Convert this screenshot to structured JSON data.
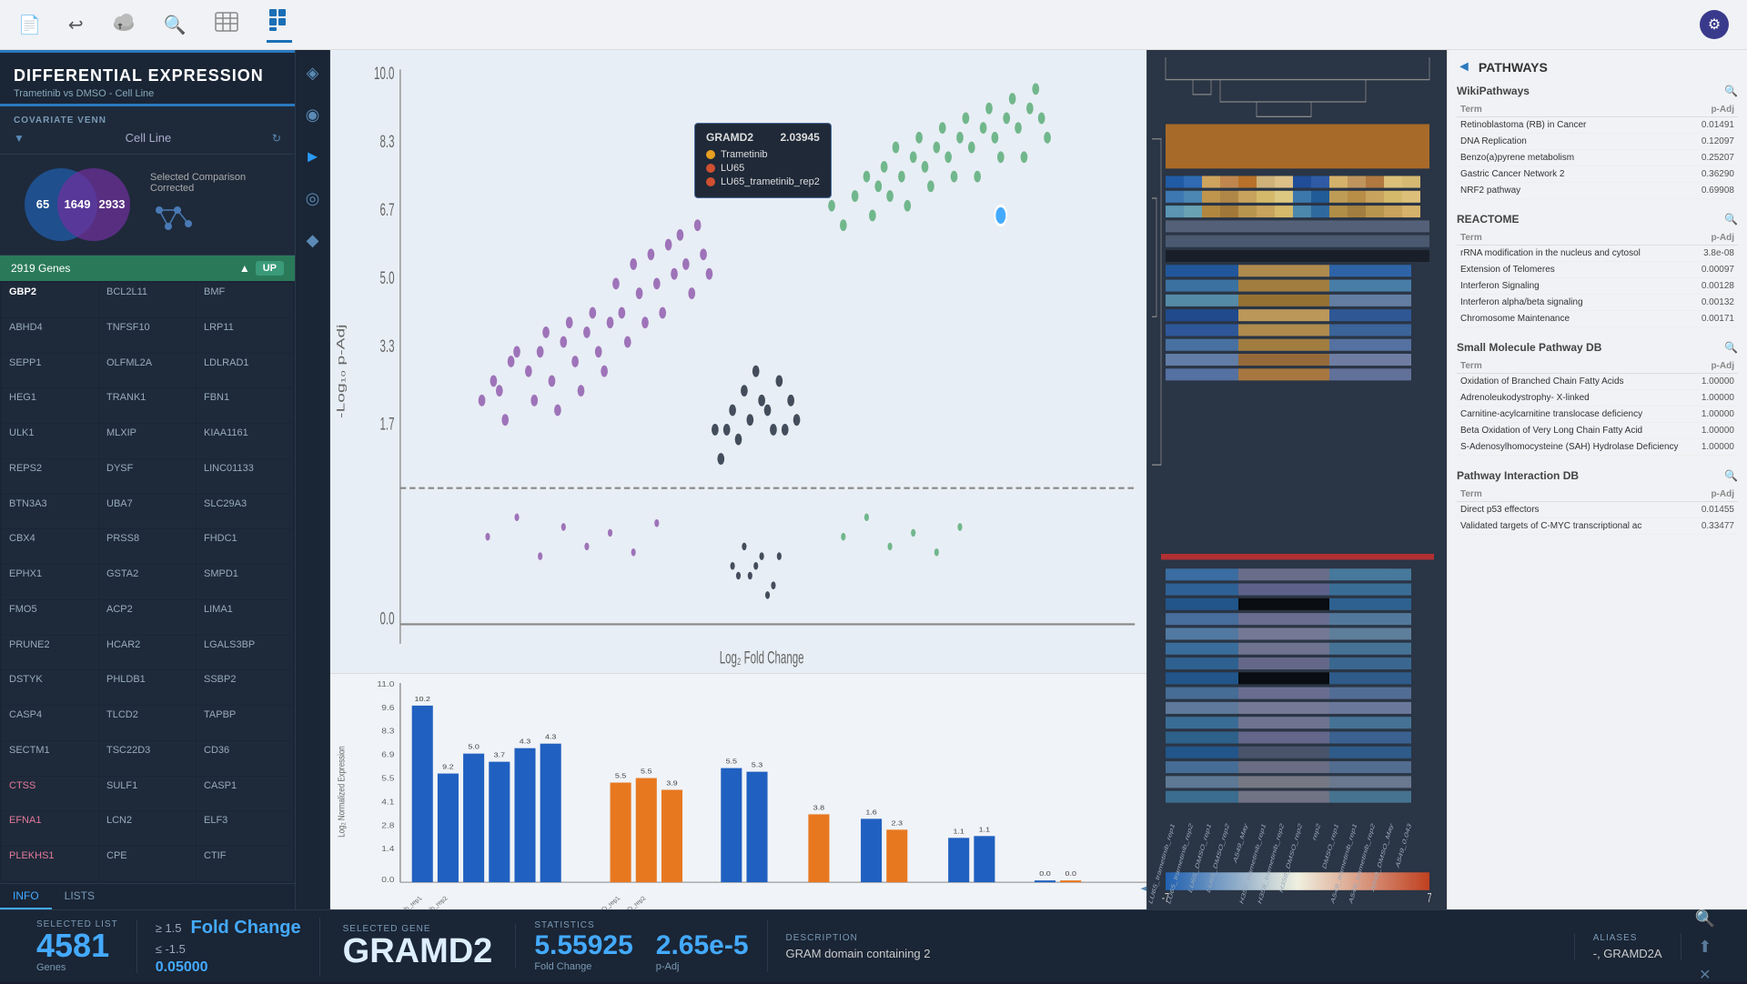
{
  "app": {
    "title": "DIFFERENTIAL EXPRESSION",
    "subtitle": "Trametinib vs DMSO - Cell Line"
  },
  "toolbar": {
    "icons": [
      "📄",
      "↩",
      "☁",
      "🔍",
      "📊",
      "⬛"
    ],
    "active_index": 5,
    "settings": "⚙"
  },
  "sidebar": {
    "covariate_label": "COVARIATE VENN",
    "cell_line_label": "Cell Line",
    "venn": {
      "left_value": "65",
      "center_value": "1649",
      "right_value": "2933",
      "selected_label": "Selected Comparison",
      "corrected_label": "Corrected"
    },
    "gene_list": {
      "count": "2919 Genes",
      "direction": "UP",
      "genes_col1": [
        "GBP2",
        "ABHD4",
        "SEPP1",
        "HEG1",
        "ULK1",
        "REPS2",
        "BTN3A3",
        "CBX4",
        "EPHX1",
        "FMO5",
        "PRUNE2",
        "DSTYK",
        "CASP4",
        "SECTM1",
        "CTSS",
        "EFNA1",
        "PLEKHS1"
      ],
      "genes_col2": [
        "BCL2L11",
        "TNFSF10",
        "OLFML2A",
        "TRANK1",
        "MLXIP",
        "DYSF",
        "UBA7",
        "PRSS8",
        "GSTA2",
        "ACP2",
        "HCAR2",
        "PHLDB1",
        "TLCD2",
        "TSC22D3",
        "SULF1",
        "LCN2",
        "CPE"
      ],
      "genes_col3": [
        "BMF",
        "LRP11",
        "LDLRAD1",
        "FBN1",
        "KIAA1161",
        "LINC01133",
        "SLC29A3",
        "FHDC1",
        "SMPD1",
        "LIMA1",
        "LGALS3BP",
        "SSBP2",
        "TAPBP",
        "CD36",
        "CASP1",
        "ELF3",
        "CTIF"
      ]
    }
  },
  "tooltip": {
    "gene": "GRAMD2",
    "value": "2.03945",
    "items": [
      {
        "label": "Trametinib",
        "color": "#e8a020"
      },
      {
        "label": "LU65",
        "color": "#d05030"
      },
      {
        "label": "LU65_trametinib_rep2",
        "color": "#d05030"
      }
    ]
  },
  "heatmap": {
    "scale_min": "-7",
    "scale_max": "7"
  },
  "pathways": {
    "title": "PATHWAYS",
    "sections": [
      {
        "name": "WikiPathways",
        "terms": [
          {
            "term": "Retinoblastoma (RB) in Cancer",
            "padj": "0.01491"
          },
          {
            "term": "DNA Replication",
            "padj": "0.12097"
          },
          {
            "term": "Benzo(a)pyrene metabolism",
            "padj": "0.25207"
          },
          {
            "term": "Gastric Cancer Network 2",
            "padj": "0.36290"
          },
          {
            "term": "NRF2 pathway",
            "padj": "0.69908"
          }
        ]
      },
      {
        "name": "REACTOME",
        "terms": [
          {
            "term": "rRNA modification in the nucleus and cytosol",
            "padj": "3.8e-08"
          },
          {
            "term": "Extension of Telomeres",
            "padj": "0.00097"
          },
          {
            "term": "Interferon Signaling",
            "padj": "0.00128"
          },
          {
            "term": "Interferon alpha/beta signaling",
            "padj": "0.00132"
          },
          {
            "term": "Chromosome Maintenance",
            "padj": "0.00171"
          }
        ]
      },
      {
        "name": "Small Molecule Pathway DB",
        "terms": [
          {
            "term": "Oxidation of Branched Chain Fatty Acids",
            "padj": "1.00000"
          },
          {
            "term": "Adrenoleukodystrophy- X-linked",
            "padj": "1.00000"
          },
          {
            "term": "Carnitine-acylcarnitine translocase deficiency",
            "padj": "1.00000"
          },
          {
            "term": "Beta Oxidation of Very Long Chain Fatty Acid",
            "padj": "1.00000"
          },
          {
            "term": "S-Adenosylhomocysteine (SAH) Hydrolase Deficiency",
            "padj": "1.00000"
          }
        ]
      },
      {
        "name": "Pathway Interaction DB",
        "terms": [
          {
            "term": "Direct p53 effectors",
            "padj": "0.01455"
          },
          {
            "term": "Validated targets of C-MYC transcriptional ac",
            "padj": "0.33477"
          }
        ]
      }
    ]
  },
  "bottom": {
    "selected_list_label": "SELECTED LIST",
    "selected_list_value": "4581",
    "genes_label": "Genes",
    "fold_change_ge": "≥ 1.5",
    "fold_change_le": "≤ -1.5",
    "padj_value": "0.05000",
    "fold_change_label": "Fold Change",
    "selected_gene_label": "SELECTED GENE",
    "selected_gene": "GRAMD2",
    "statistics_label": "STATISTICS",
    "fold_change_stat": "5.55925",
    "padj_stat": "2.65e-5",
    "fold_change_stat_label": "Fold Change",
    "padj_stat_label": "p-Adj",
    "description_label": "DESCRIPTION",
    "description_value": "GRAM domain containing 2",
    "aliases_label": "ALIASES",
    "aliases_value": "-, GRAMD2A"
  },
  "tabs": {
    "info": "INFO",
    "lists": "LISTS"
  },
  "side_nav": {
    "icons": [
      "◈",
      "◉",
      "►",
      "◎",
      "◆"
    ]
  }
}
